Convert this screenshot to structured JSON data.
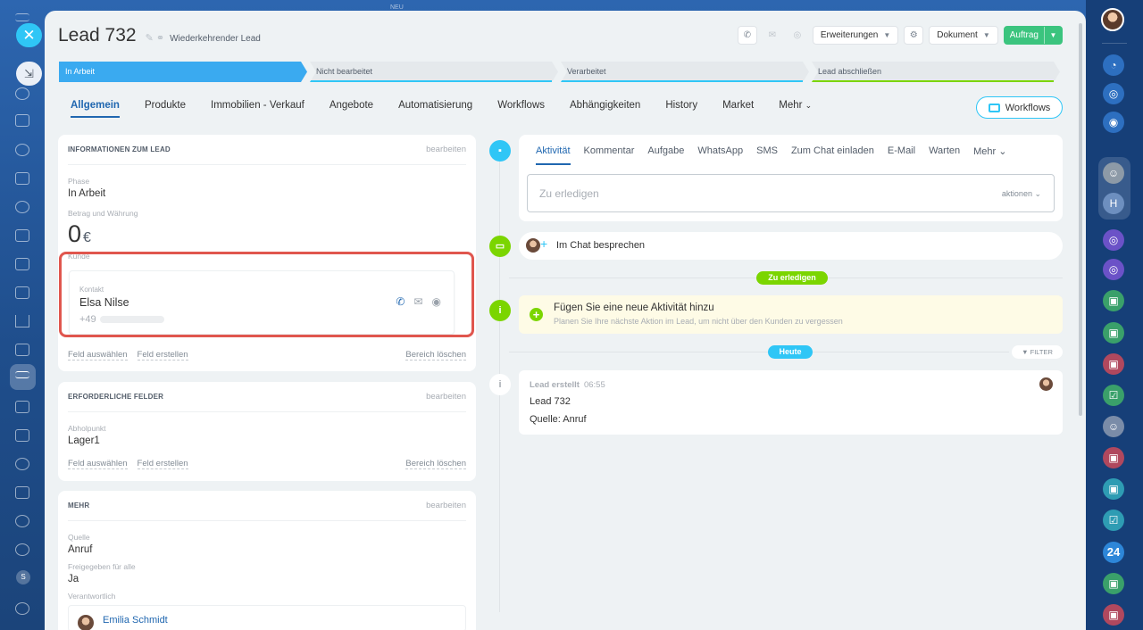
{
  "window": {
    "top_label": "NEU"
  },
  "lead": {
    "title": "Lead 732",
    "subtitle": "Wiederkehrender Lead"
  },
  "toolbar": {
    "extensions": "Erweiterungen",
    "document": "Dokument",
    "order": "Auftrag"
  },
  "stages": [
    {
      "label": "In Arbeit",
      "color": "#3aaaf0",
      "active": true
    },
    {
      "label": "Nicht bearbeitet",
      "color": "#2fc6f6",
      "active": false
    },
    {
      "label": "Verarbeitet",
      "color": "#2fc6f6",
      "active": false
    },
    {
      "label": "Lead abschließen",
      "color": "#7bd500",
      "active": false
    }
  ],
  "tabs": [
    "Allgemein",
    "Produkte",
    "Immobilien - Verkauf",
    "Angebote",
    "Automatisierung",
    "Workflows",
    "Abhängigkeiten",
    "History",
    "Market",
    "Mehr"
  ],
  "workflows_button": "Workflows",
  "info_card": {
    "title": "INFORMATIONEN ZUM LEAD",
    "edit": "bearbeiten",
    "phase_label": "Phase",
    "phase_value": "In Arbeit",
    "amount_label": "Betrag und Währung",
    "amount_value": "0",
    "currency": "€",
    "client_label": "Kunde",
    "contact_label": "Kontakt",
    "contact_name": "Elsa Nilse",
    "contact_phone": "+49",
    "link_select": "Feld auswählen",
    "link_create": "Feld erstellen",
    "link_delete": "Bereich löschen"
  },
  "required_card": {
    "title": "ERFORDERLICHE FELDER",
    "edit": "bearbeiten",
    "pickup_label": "Abholpunkt",
    "pickup_value": "Lager1",
    "link_select": "Feld auswählen",
    "link_create": "Feld erstellen",
    "link_delete": "Bereich löschen"
  },
  "more_card": {
    "title": "MEHR",
    "edit": "bearbeiten",
    "source_label": "Quelle",
    "source_value": "Anruf",
    "shared_label": "Freigegeben für alle",
    "shared_value": "Ja",
    "responsible_label": "Verantwortlich",
    "responsible_name": "Emilia Schmidt"
  },
  "composer": {
    "tabs": [
      "Aktivität",
      "Kommentar",
      "Aufgabe",
      "WhatsApp",
      "SMS",
      "Zum Chat einladen",
      "E-Mail",
      "Warten",
      "Mehr"
    ],
    "placeholder": "Zu erledigen",
    "actions": "aktionen"
  },
  "timeline": {
    "chat_label": "Im Chat besprechen",
    "todo_pill": "Zu erledigen",
    "todo_title": "Fügen Sie eine neue Aktivität hinzu",
    "todo_hint": "Planen Sie Ihre nächste Aktion im Lead, um nicht über den Kunden zu vergessen",
    "today_pill": "Heute",
    "filter": "FILTER",
    "event_title": "Lead erstellt",
    "event_time": "06:55",
    "event_line1": "Lead 732",
    "event_line2": "Quelle: Anruf"
  },
  "right_rail": {
    "badge_24": "24"
  },
  "colors": {
    "accent": "#2067b0",
    "stage_active": "#3aaaf0",
    "success": "#3bc47e",
    "highlight": "#e0564e",
    "lime": "#7bd500",
    "cyan": "#2fc6f6"
  }
}
